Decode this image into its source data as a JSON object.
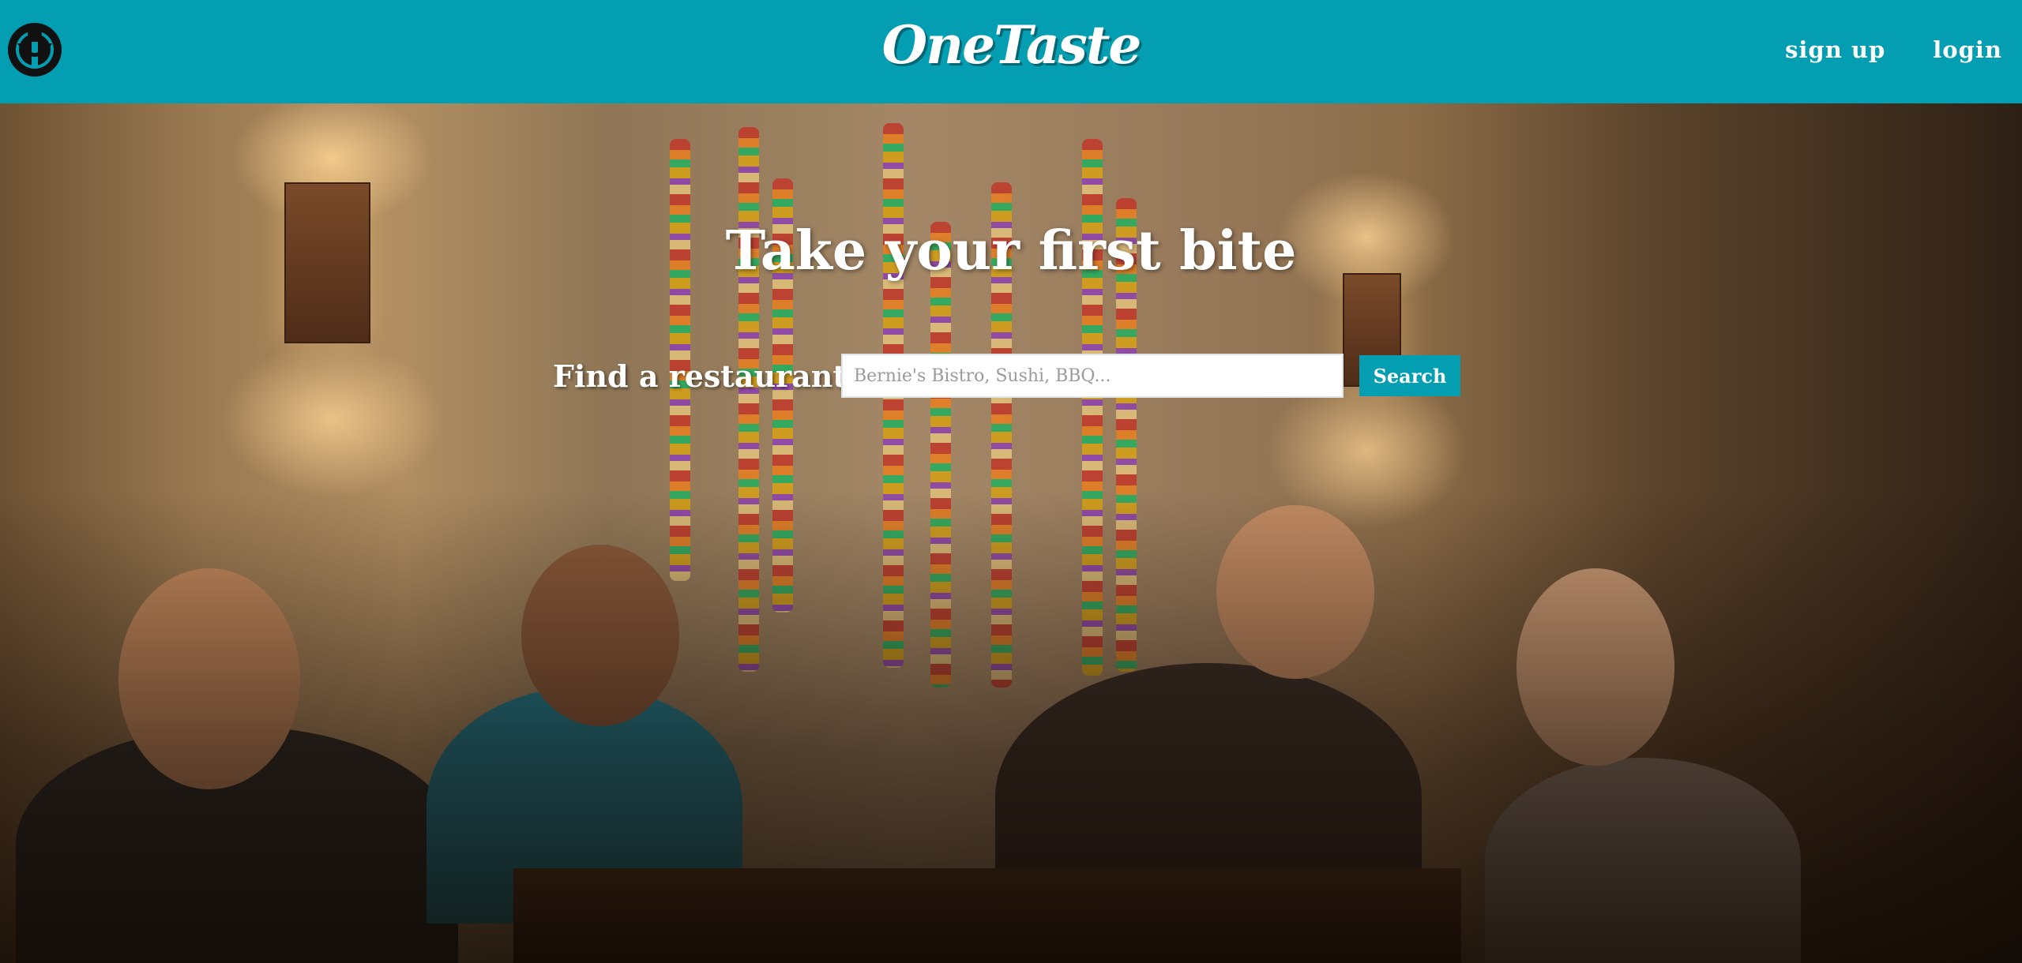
{
  "header": {
    "brand": "OneTaste",
    "logo_icon": "wikimedia-logo-icon",
    "nav": [
      {
        "label": "sign up"
      },
      {
        "label": "login"
      }
    ],
    "colors": {
      "bar": "#039eb2",
      "text": "#ffffff"
    }
  },
  "hero": {
    "title": "Take your first bite",
    "background_image": "restaurant-diners-photo",
    "search": {
      "label": "Find a restaurant:",
      "placeholder": "Bernie's Bistro, Sushi, BBQ...",
      "value": "",
      "button_label": "Search",
      "button_color": "#039eb2"
    }
  }
}
